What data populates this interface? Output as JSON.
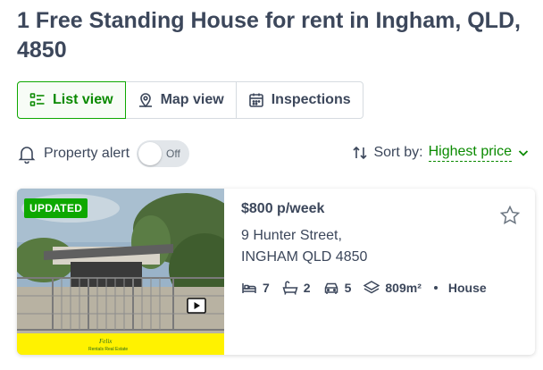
{
  "page": {
    "title": "1 Free Standing House for rent in Ingham, QLD, 4850"
  },
  "view_tabs": [
    {
      "label": "List view",
      "icon": "list-icon",
      "active": true
    },
    {
      "label": "Map view",
      "icon": "map-pin-icon",
      "active": false
    },
    {
      "label": "Inspections",
      "icon": "calendar-icon",
      "active": false
    }
  ],
  "property_alert": {
    "label": "Property alert",
    "toggle_state": "Off"
  },
  "sort": {
    "label": "Sort by:",
    "value": "Highest price"
  },
  "listing": {
    "badge": "UPDATED",
    "price": "$800 p/week",
    "address_line1": "9 Hunter Street,",
    "address_line2": "INGHAM QLD 4850",
    "bedrooms": "7",
    "bathrooms": "2",
    "parking": "5",
    "land_size": "809m²",
    "property_type": "House",
    "agency_banner_color": "#ffee00"
  },
  "colors": {
    "accent": "#0a8a00",
    "badge": "#0ea800",
    "text": "#3c475b"
  }
}
